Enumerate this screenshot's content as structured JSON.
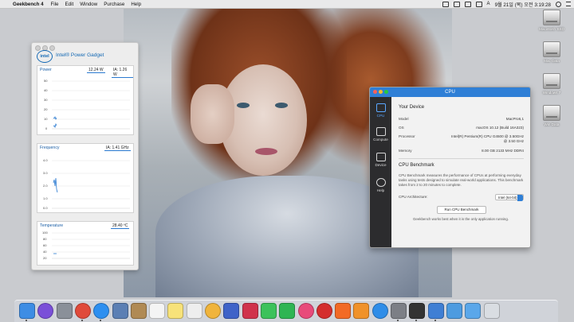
{
  "menubar": {
    "app_name": "Geekbench 4",
    "items": [
      "File",
      "Edit",
      "Window",
      "Purchase",
      "Help"
    ],
    "clock": "9월 21일 (목) 오전 3:19:28"
  },
  "desktop_icons": [
    {
      "label": "Macintosh SSD"
    },
    {
      "label": "Mac Data"
    },
    {
      "label": "Windows 7"
    },
    {
      "label": "Win Data"
    }
  ],
  "power_gadget": {
    "title": "Intel® Power Gadget",
    "logo_text": "intel",
    "power": {
      "label": "Power",
      "reading1": "12.24 W",
      "reading2": "IA: 1.26 W",
      "yticks": [
        "50",
        "40",
        "30",
        "20",
        "10",
        "0"
      ]
    },
    "frequency": {
      "label": "Frequency",
      "reading": "IA: 1.41 GHz",
      "yticks": [
        "4.0",
        "3.0",
        "2.0",
        "1.0",
        "0.0"
      ]
    },
    "temperature": {
      "label": "Temperature",
      "reading": "28.40 ºC",
      "yticks": [
        "100",
        "80",
        "60",
        "40",
        "20"
      ]
    }
  },
  "geekbench": {
    "window_title": "CPU",
    "sidebar": [
      {
        "label": "CPU"
      },
      {
        "label": "Compute"
      },
      {
        "label": "Device"
      },
      {
        "label": "Help"
      }
    ],
    "your_device": {
      "title": "Your Device",
      "rows": [
        {
          "key": "Model",
          "value": "MacPro6,1"
        },
        {
          "key": "OS",
          "value": "macOS 10.12 (Build 16A323)"
        },
        {
          "key": "Processor",
          "value": "Intel(R) Pentium(R) CPU G4500 @ 3.50GHz @ 3.50 GHz"
        },
        {
          "key": "Memory",
          "value": "8.00 GB 2133 MHz DDR4"
        }
      ]
    },
    "benchmark": {
      "title": "CPU Benchmark",
      "description": "CPU Benchmark measures the performance of CPUs at performing everyday tasks using tests designed to simulate real-world applications. This benchmark takes from 2 to 20 minutes to complete.",
      "arch_label": "CPU Architecture:",
      "arch_value": "Intel (64-bit)",
      "run_button": "Run CPU Benchmark",
      "hint": "Geekbench works best when it is the only application running."
    }
  },
  "dock": {
    "icons": [
      {
        "name": "finder",
        "color": "#3d8de4"
      },
      {
        "name": "siri",
        "color": "#7a4fd8"
      },
      {
        "name": "launchpad",
        "color": "#8a9099"
      },
      {
        "name": "chrome",
        "color": "#e04a3a"
      },
      {
        "name": "safari",
        "color": "#2d8ff0"
      },
      {
        "name": "preview",
        "color": "#5b7fb4"
      },
      {
        "name": "contacts",
        "color": "#b08a55"
      },
      {
        "name": "calendar",
        "color": "#f4f4f4"
      },
      {
        "name": "notes",
        "color": "#f7e27a"
      },
      {
        "name": "reminders",
        "color": "#eeeeee"
      },
      {
        "name": "photos",
        "color": "#f0b43c"
      },
      {
        "name": "keynote",
        "color": "#3f63c8"
      },
      {
        "name": "photo-booth",
        "color": "#d0324b"
      },
      {
        "name": "messages",
        "color": "#3cc25b"
      },
      {
        "name": "facetime",
        "color": "#2fb553"
      },
      {
        "name": "itunes",
        "color": "#e84a7a"
      },
      {
        "name": "netease-music",
        "color": "#d42d2d"
      },
      {
        "name": "xiami",
        "color": "#f26a25"
      },
      {
        "name": "ibooks",
        "color": "#f0922a"
      },
      {
        "name": "app-store",
        "color": "#2f8de8"
      },
      {
        "name": "system-preferences",
        "color": "#7c7f86"
      },
      {
        "name": "activity-monitor",
        "color": "#333333"
      },
      {
        "name": "geekbench",
        "color": "#3f7fd4"
      },
      {
        "name": "downloads",
        "color": "#4d9be0"
      },
      {
        "name": "applications",
        "color": "#5aa7ea"
      },
      {
        "name": "trash",
        "color": "#d9dde2"
      }
    ]
  }
}
